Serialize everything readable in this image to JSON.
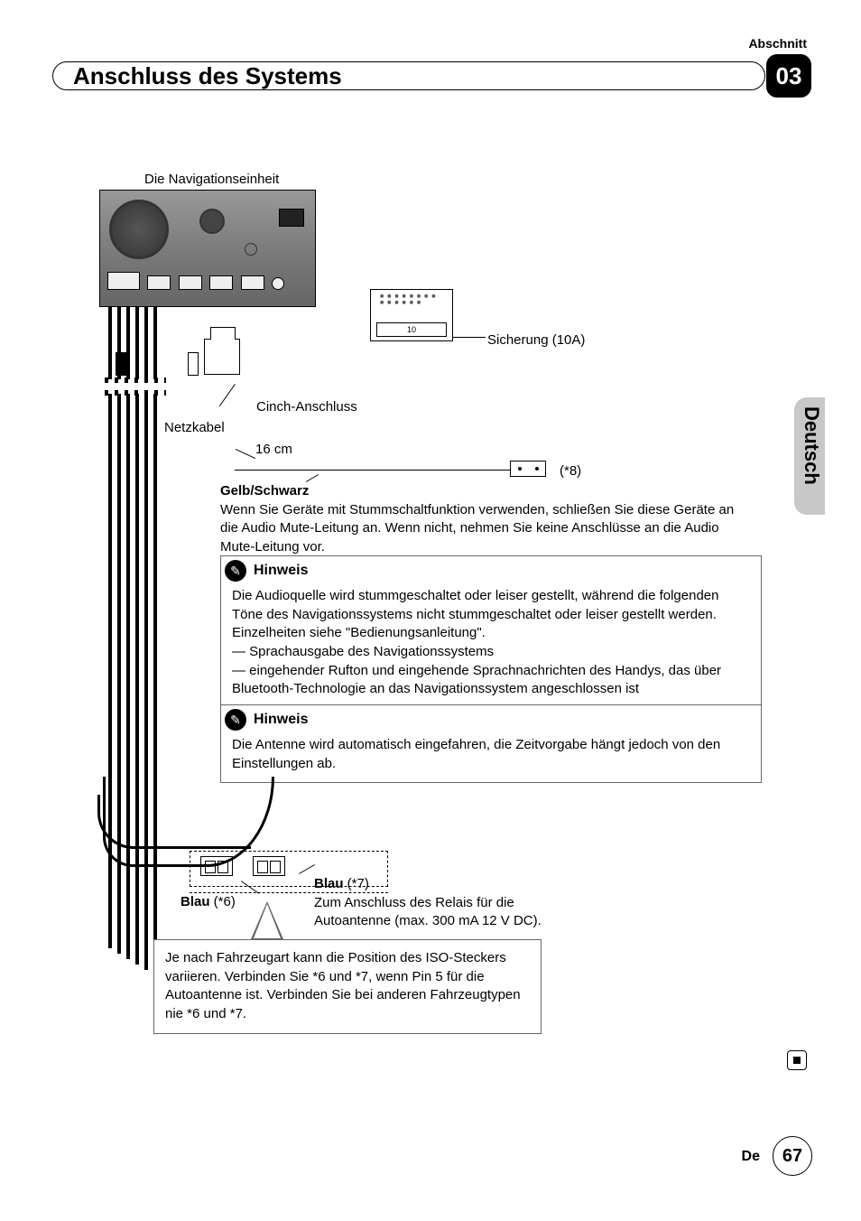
{
  "header": {
    "section_word": "Abschnitt",
    "title": "Anschluss des Systems",
    "section_number": "03"
  },
  "side": {
    "language": "Deutsch"
  },
  "diagram": {
    "nav_unit_label": "Die Navigationseinheit",
    "fuse_text": "10",
    "fuse_label": "Sicherung (10A)",
    "cinch_label": "Cinch-Anschluss",
    "power_cable_label": "Netzkabel",
    "length_label": "16 cm",
    "ref8": "(*8)",
    "yellow_black": {
      "label": "Gelb/Schwarz",
      "text": "Wenn Sie Geräte mit Stummschaltfunktion verwenden, schließen Sie diese Geräte an die Audio Mute-Leitung an. Wenn nicht, nehmen Sie keine Anschlüsse an die Audio Mute-Leitung vor."
    }
  },
  "hinweis1": {
    "title": "Hinweis",
    "line1": "Die Audioquelle wird stummgeschaltet oder leiser gestellt, während die folgenden Töne des Navigationssystems nicht stummgeschaltet oder leiser gestellt werden. Einzelheiten siehe \"Bedienungsanleitung\".",
    "dash1": "— Sprachausgabe des Navigationssystems",
    "dash2": "— eingehender Rufton und eingehende Sprachnachrichten des Handys, das über Bluetooth-Technologie an das Navigationssystem angeschlossen ist"
  },
  "hinweis2": {
    "title": "Hinweis",
    "text": "Die Antenne wird automatisch eingefahren, die Zeitvorgabe hängt jedoch von den Einstellungen ab."
  },
  "antenna": {
    "blau6_bold": "Blau",
    "blau6_ref": " (*6)",
    "blau7_bold": "Blau",
    "blau7_ref": " (*7)",
    "blau7_text": "Zum Anschluss des Relais für die Autoantenne (max. 300 mA 12 V DC).",
    "iso_note": "Je nach Fahrzeugart kann die Position des ISO-Steckers variieren. Verbinden Sie *6 und *7, wenn Pin 5 für die Autoantenne ist. Verbinden Sie bei anderen Fahrzeugtypen nie *6 und *7."
  },
  "footer": {
    "lang_code": "De",
    "page": "67"
  }
}
